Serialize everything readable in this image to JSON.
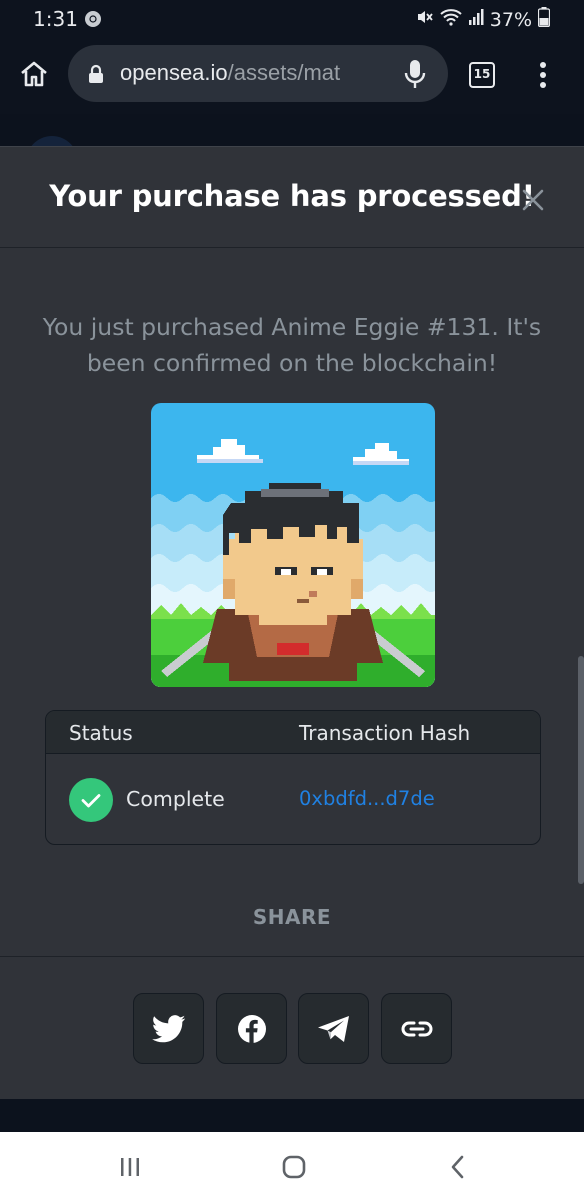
{
  "status_bar": {
    "time": "1:31",
    "battery": "37%",
    "icons": [
      "chrome-icon",
      "mute-icon",
      "wifi-icon",
      "signal-icon",
      "battery-icon"
    ]
  },
  "browser": {
    "url_domain": "opensea.io",
    "url_path": "/assets/mat",
    "tab_count": "15",
    "icons": [
      "home-icon",
      "lock-icon",
      "mic-icon",
      "more-vert-icon"
    ]
  },
  "modal": {
    "title": "Your purchase has processed!",
    "message": "You just purchased Anime Eggie #131. It's been confirmed on the blockchain!",
    "image_alt": "Anime Eggie #131",
    "table": {
      "header_status": "Status",
      "header_hash": "Transaction Hash",
      "status_value": "Complete",
      "hash_value": "0xbdfd...d7de"
    },
    "share_label": "SHARE",
    "share_buttons": [
      "twitter-icon",
      "facebook-icon",
      "telegram-icon",
      "link-icon"
    ]
  },
  "colors": {
    "modal_bg": "#303339",
    "accent_link": "#2081e2",
    "success": "#34c77b"
  }
}
